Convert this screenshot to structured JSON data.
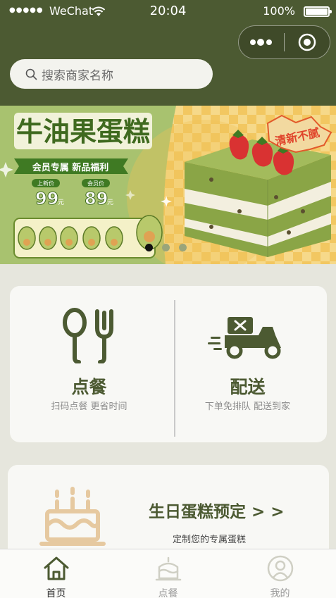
{
  "status_bar": {
    "signal": "●●●●●",
    "carrier": "WeChat",
    "time": "20:04",
    "battery": "100%"
  },
  "header": {
    "search_placeholder": "搜索商家名称",
    "brand_color": "#4c5a32"
  },
  "banner": {
    "title": "牛油果蛋糕",
    "tagline": "会员专属 新品福利",
    "badge": "清新不腻",
    "prices": [
      {
        "label": "上新价",
        "value": "99",
        "unit": "元"
      },
      {
        "label": "会员价",
        "value": "89",
        "unit": "元"
      }
    ],
    "slides": 3,
    "active_slide": 1
  },
  "services": [
    {
      "title": "点餐",
      "subtitle": "扫码点餐 更省时间",
      "icon": "fork-spoon-icon"
    },
    {
      "title": "配送",
      "subtitle": "下单免排队 配送到家",
      "icon": "delivery-scooter-icon"
    }
  ],
  "promo": {
    "title": "生日蛋糕预定 > >",
    "subtitle": "定制您的专属蛋糕",
    "icon": "birthday-cake-icon"
  },
  "tabbar": [
    {
      "label": "首页",
      "icon": "home-icon",
      "active": true
    },
    {
      "label": "点餐",
      "icon": "cake-icon",
      "active": false
    },
    {
      "label": "我的",
      "icon": "user-icon",
      "active": false
    }
  ]
}
